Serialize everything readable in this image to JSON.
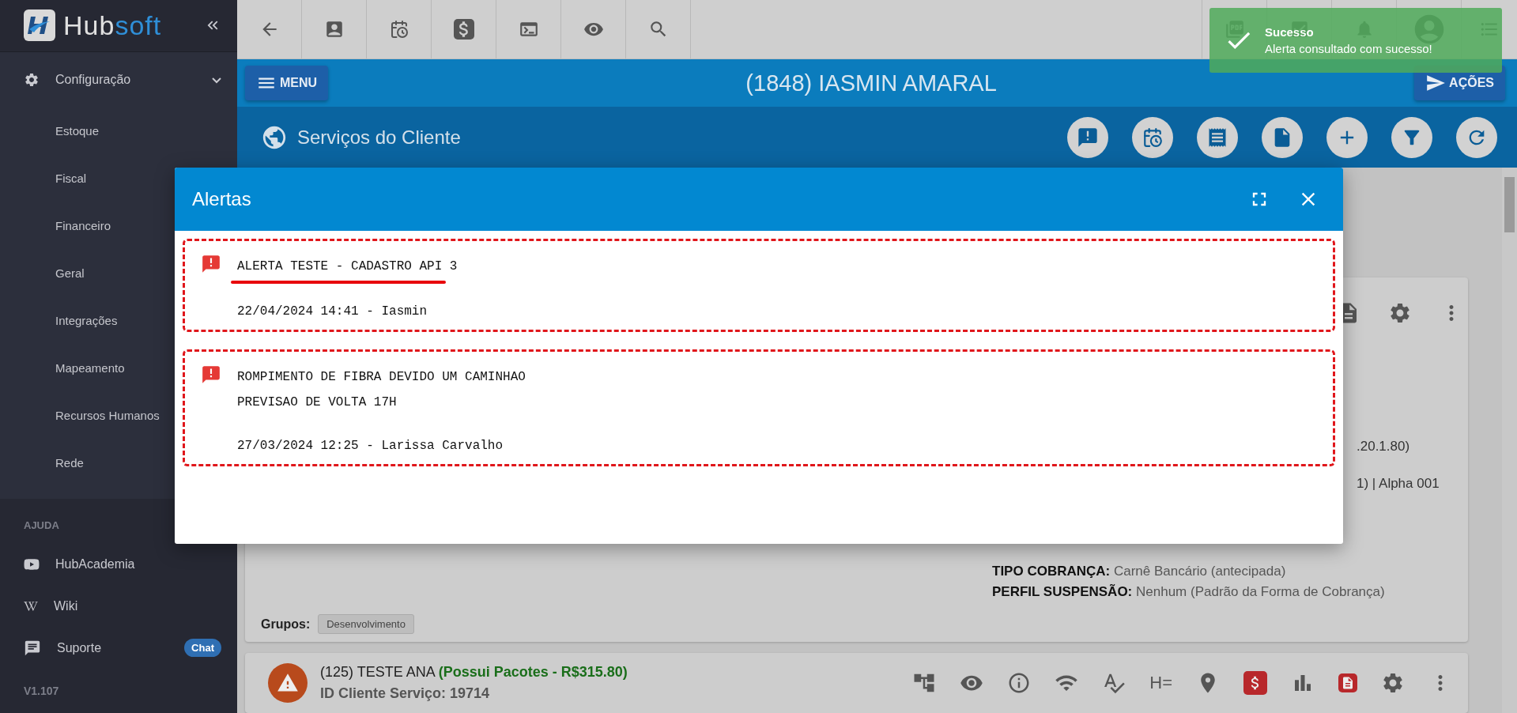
{
  "sidebar": {
    "logo": {
      "part_1": "Hub",
      "part_2": "soft"
    },
    "group": {
      "label": "Configuração",
      "expanded": true,
      "children": [
        {
          "label": "Estoque"
        },
        {
          "label": "Fiscal"
        },
        {
          "label": "Financeiro"
        },
        {
          "label": "Geral"
        },
        {
          "label": "Integrações"
        },
        {
          "label": "Mapeamento"
        },
        {
          "label": "Recursos Humanos"
        },
        {
          "label": "Rede"
        }
      ]
    },
    "help_heading": "AJUDA",
    "help_items": [
      {
        "kind": "video",
        "label": "HubAcademia"
      },
      {
        "kind": "wiki",
        "label": "Wiki"
      },
      {
        "kind": "chat",
        "label": "Suporte",
        "badge": "Chat"
      }
    ],
    "version": "V1.107"
  },
  "header": {
    "menu_button": "MENU",
    "client_title": "(1848) IASMIN AMARAL",
    "actions_button": "AÇÕES",
    "section_title": "Serviços do Cliente"
  },
  "toast": {
    "title": "Sucesso",
    "message": "Alerta consultado com sucesso!"
  },
  "service_card": {
    "details": [
      ".20.1.80)",
      "1) | Alpha 001"
    ],
    "fields": [
      {
        "label": "TIPO COBRANÇA:",
        "value": "Carnê Bancário (antecipada)"
      },
      {
        "label": "PERFIL SUSPENSÃO:",
        "value": "Nenhum (Padrão da Forma de Cobrança)"
      }
    ],
    "groups_label": "Grupos:",
    "groups": [
      "Desenvolvimento"
    ]
  },
  "second_card": {
    "name": "(125) TESTE ANA",
    "packages": "(Possui Pacotes - R$315.80)",
    "id_line": "ID Cliente Serviço: 19714",
    "icon_text": "H="
  },
  "modal": {
    "title": "Alertas",
    "alerts": [
      {
        "lines": [
          "ALERTA TESTE - CADASTRO API 3"
        ],
        "meta": "22/04/2024 14:41 - Iasmin",
        "highlighted": true
      },
      {
        "lines": [
          "ROMPIMENTO DE FIBRA DEVIDO UM CAMINHAO",
          "PREVISAO DE VOLTA 17H"
        ],
        "meta": "27/03/2024 12:25 - Larissa Carvalho",
        "highlighted": false
      }
    ]
  }
}
